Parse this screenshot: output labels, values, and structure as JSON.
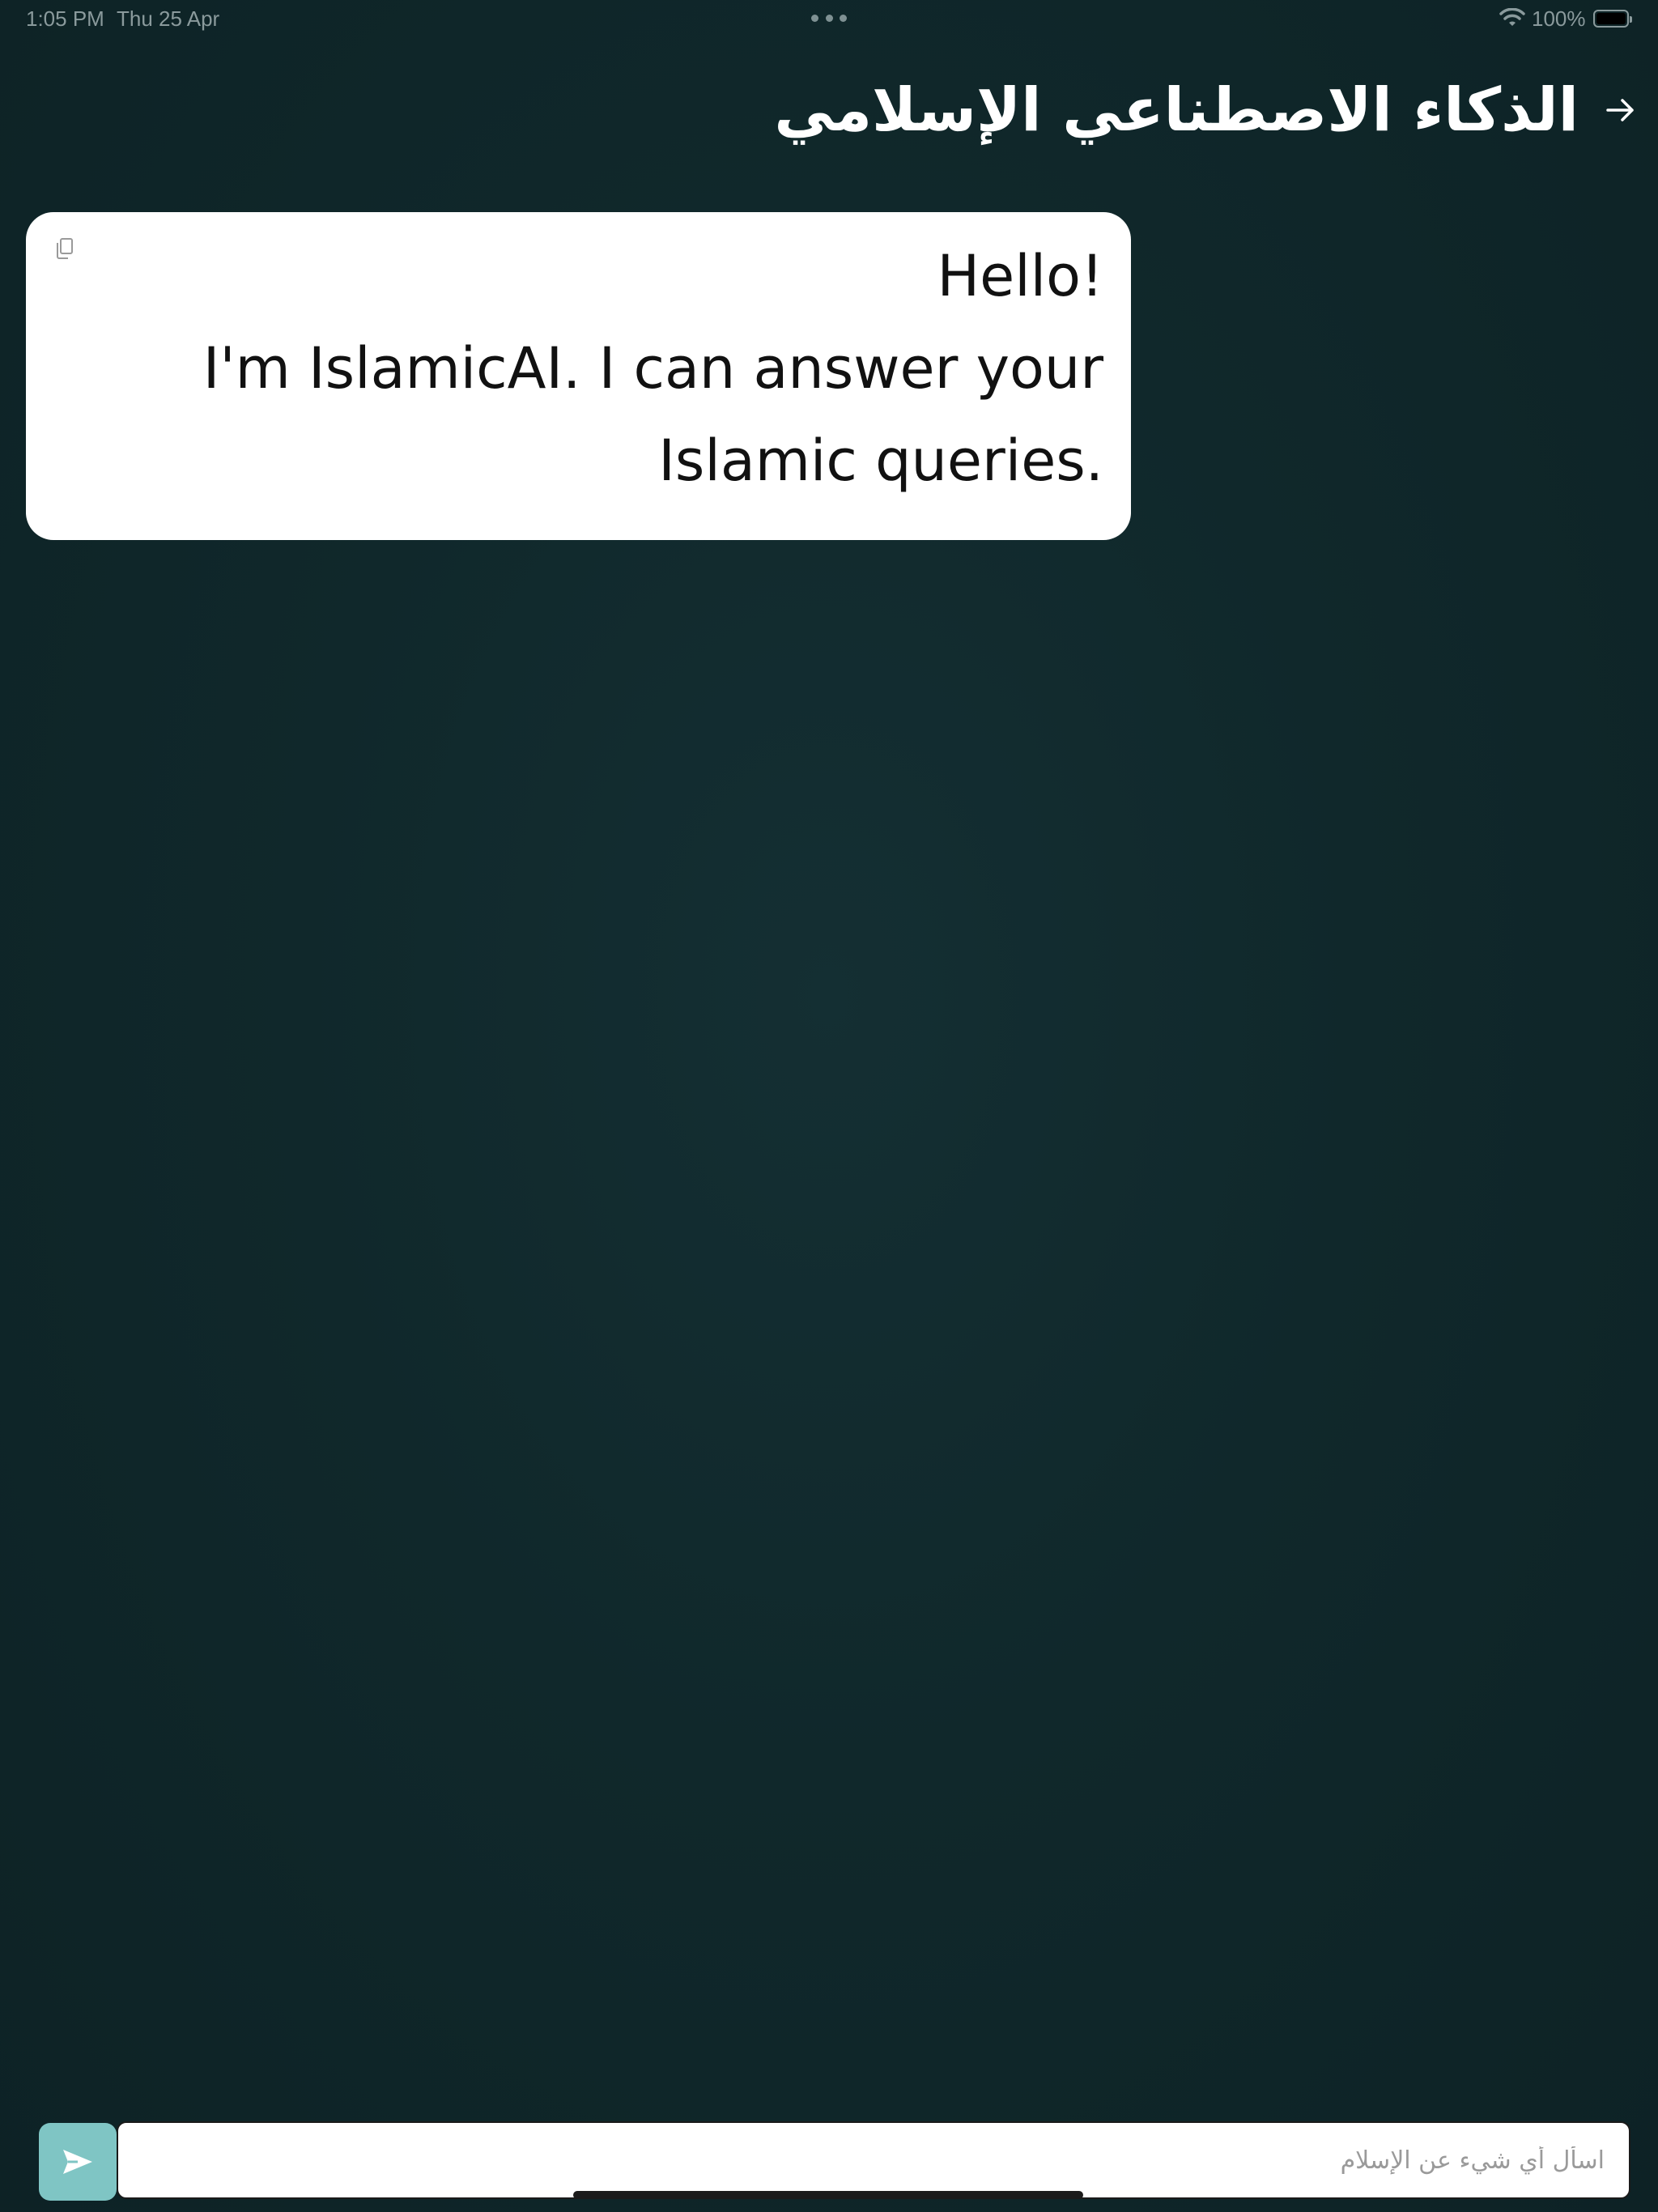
{
  "status_bar": {
    "time": "1:05 PM",
    "date": "Thu 25 Apr",
    "battery_percent": "100%",
    "battery_level": 1.0,
    "icons": [
      "more-dots-icon",
      "wifi-icon",
      "battery-icon"
    ]
  },
  "header": {
    "title": "الذكاء الاصطناعي الإسلامي",
    "back_icon": "arrow-right-icon"
  },
  "chat": {
    "messages": [
      {
        "sender": "assistant",
        "lines": [
          "!Hello",
          "I'm IslamicAI. I can answer your",
          ".Islamic queries"
        ],
        "copy_icon": "copy-icon"
      }
    ]
  },
  "composer": {
    "placeholder": "اسأل أي شيء عن الإسلام",
    "value": "",
    "send_icon": "send-icon"
  },
  "colors": {
    "background": "#10282b",
    "bubble": "#ffffff",
    "send_button": "#7fc5c4",
    "title_text": "#ffffff"
  }
}
